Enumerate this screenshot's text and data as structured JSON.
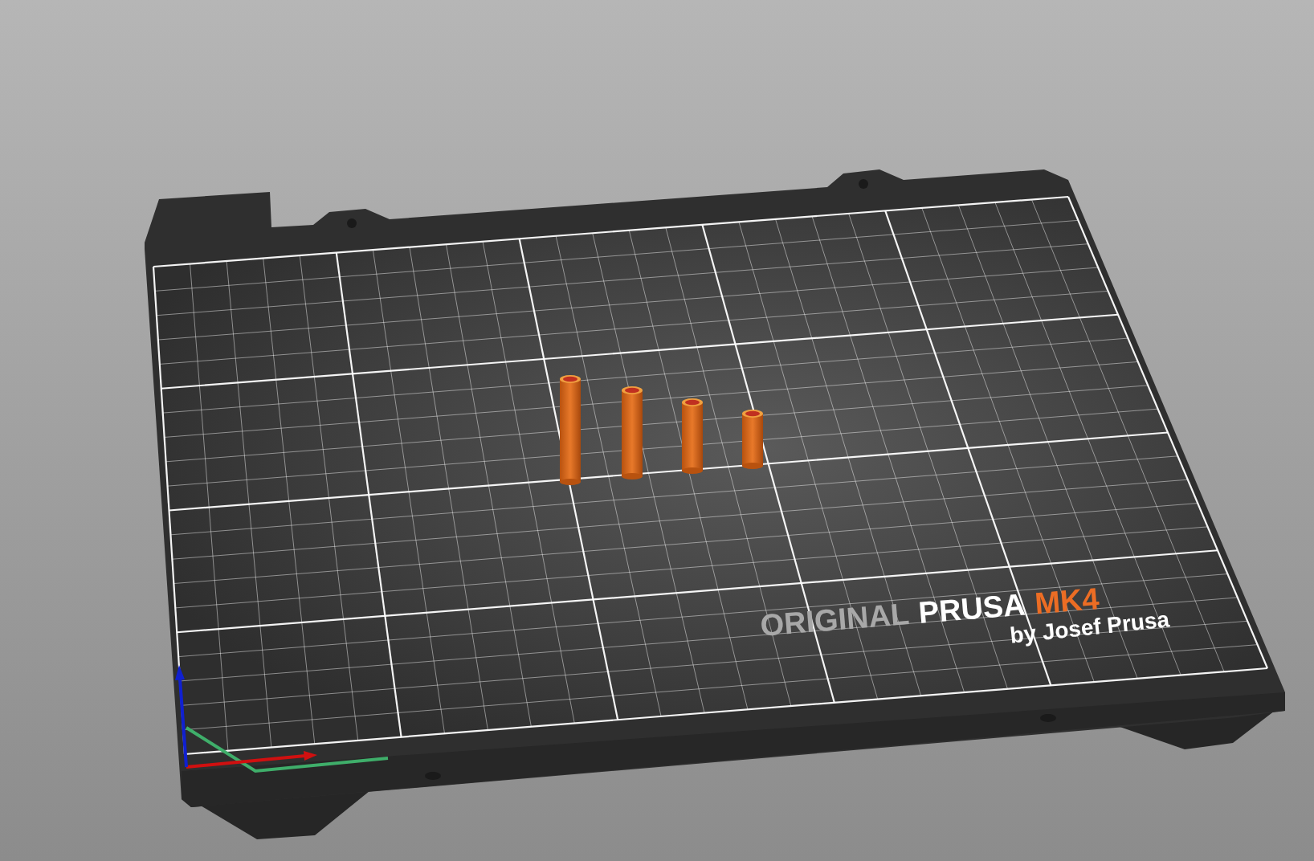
{
  "bed_logo": {
    "prefix": "ORIGINAL",
    "brand": "PRUSA",
    "model": "MK4",
    "tagline": "by Josef Prusa"
  }
}
